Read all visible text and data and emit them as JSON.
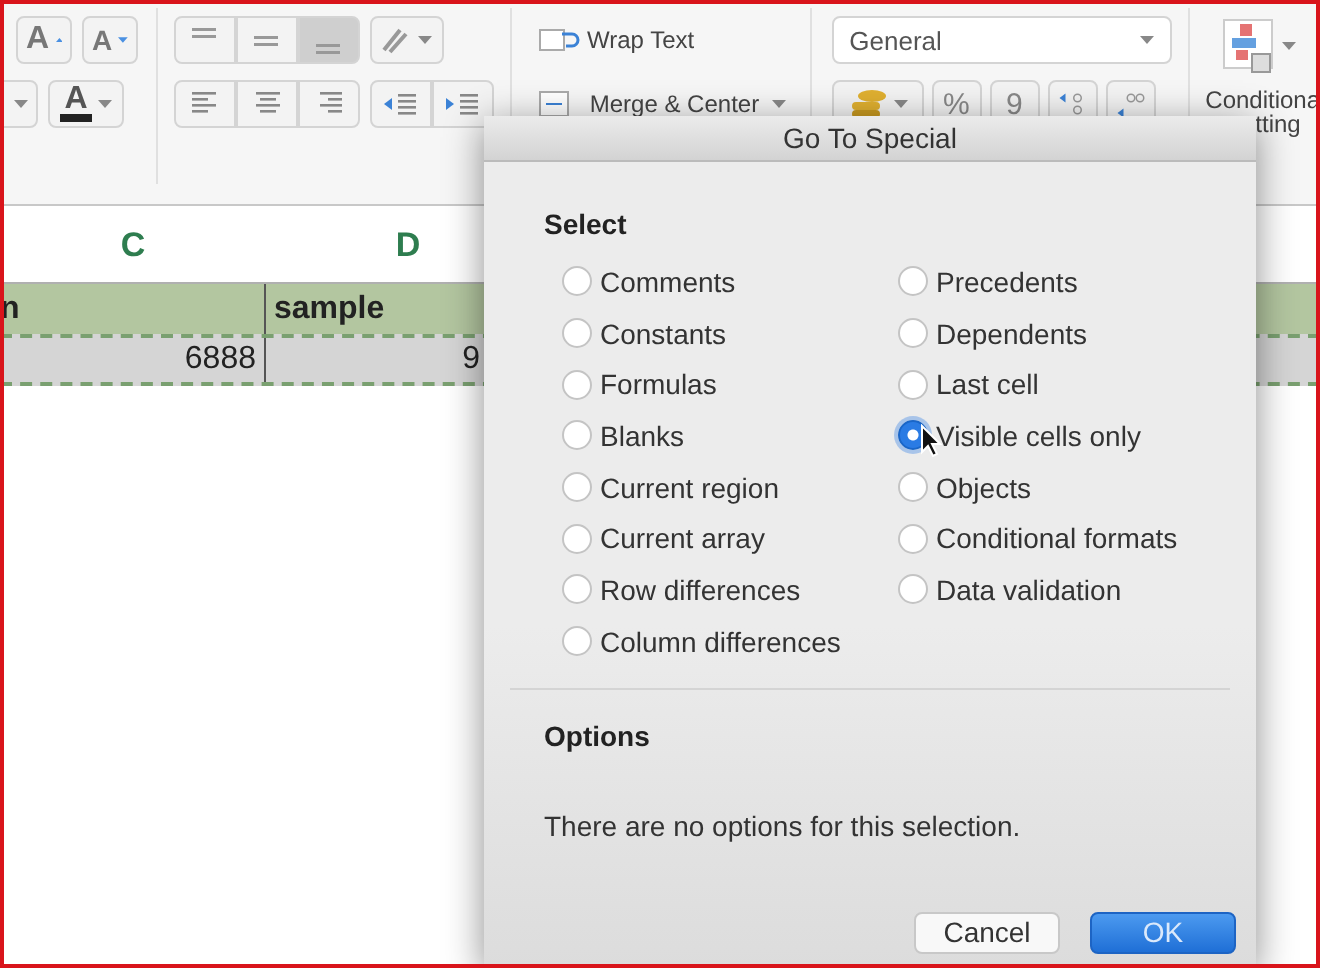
{
  "ribbon": {
    "font": {
      "grow_button": "A",
      "shrink_button": "A",
      "color_button": "A"
    },
    "alignment": {
      "vertical": [
        {
          "kind": "top",
          "selected": false
        },
        {
          "kind": "middle",
          "selected": false
        },
        {
          "kind": "bottom",
          "selected": true
        }
      ],
      "horizontal": [
        {
          "kind": "left"
        },
        {
          "kind": "center"
        },
        {
          "kind": "right"
        }
      ]
    },
    "wrap_text": "Wrap Text",
    "merge_center": "Merge & Center",
    "number_format": {
      "value": "General"
    },
    "number_buttons": [
      {
        "kind": "accounting"
      },
      {
        "kind": "percent",
        "label": "%"
      },
      {
        "kind": "comma",
        "label": "9"
      },
      {
        "kind": "increase_decimal"
      },
      {
        "kind": "decrease_decimal"
      }
    ],
    "conditional_formatting": {
      "line_1": "Conditiona",
      "line_2": "tting"
    }
  },
  "sheet": {
    "columns": [
      "C",
      "D"
    ],
    "rows": [
      {
        "kind": "header",
        "cells": [
          "n",
          "sample"
        ]
      },
      {
        "kind": "number",
        "cells": [
          "6888",
          "9"
        ]
      }
    ]
  },
  "dialog": {
    "title": "Go To Special",
    "select_heading": "Select",
    "left_options": [
      {
        "label": "Comments",
        "selected": false
      },
      {
        "label": "Constants",
        "selected": false
      },
      {
        "label": "Formulas",
        "selected": false
      },
      {
        "label": "Blanks",
        "selected": false
      },
      {
        "label": "Current region",
        "selected": false
      },
      {
        "label": "Current array",
        "selected": false
      },
      {
        "label": "Row differences",
        "selected": false
      },
      {
        "label": "Column differences",
        "selected": false
      }
    ],
    "right_options": [
      {
        "label": "Precedents",
        "selected": false
      },
      {
        "label": "Dependents",
        "selected": false
      },
      {
        "label": "Last cell",
        "selected": false
      },
      {
        "label": "Visible cells only",
        "selected": true
      },
      {
        "label": "Objects",
        "selected": false
      },
      {
        "label": "Conditional formats",
        "selected": false
      },
      {
        "label": "Data validation",
        "selected": false
      }
    ],
    "options_heading": "Options",
    "options_message": "There are no options for this selection.",
    "buttons": [
      {
        "label": "Cancel",
        "kind": "secondary"
      },
      {
        "label": "OK",
        "kind": "default"
      }
    ]
  }
}
